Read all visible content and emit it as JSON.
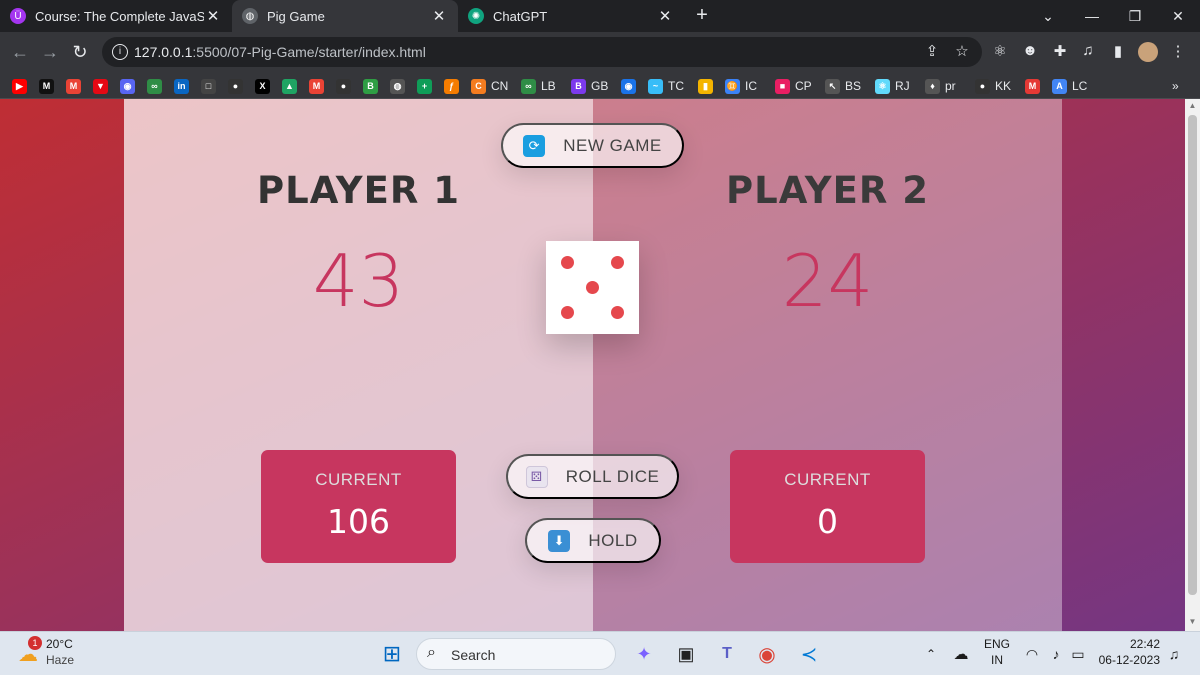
{
  "browser": {
    "tabs": [
      {
        "title": "Course: The Complete JavaScript",
        "icon": "udemy-icon",
        "color": "#a435f0"
      },
      {
        "title": "Pig Game",
        "icon": "globe-icon",
        "color": "#8ab4f8"
      },
      {
        "title": "ChatGPT",
        "icon": "chatgpt-icon",
        "color": "#10a37f"
      }
    ],
    "url_host": "127.0.0.1",
    "url_path": ":5500/07-Pig-Game/starter/index.html",
    "bookmarks": [
      {
        "label": "",
        "color": "#ff0000",
        "glyph": "▶"
      },
      {
        "label": "",
        "color": "#111111",
        "glyph": "M"
      },
      {
        "label": "",
        "color": "#ea4335",
        "glyph": "M"
      },
      {
        "label": "",
        "color": "#e50914",
        "glyph": "▼"
      },
      {
        "label": "",
        "color": "#5865f2",
        "glyph": "◉"
      },
      {
        "label": "",
        "color": "#2f8d46",
        "glyph": "∞"
      },
      {
        "label": "",
        "color": "#0a66c2",
        "glyph": "in"
      },
      {
        "label": "",
        "color": "#444444",
        "glyph": "□"
      },
      {
        "label": "",
        "color": "#333333",
        "glyph": "●"
      },
      {
        "label": "",
        "color": "#000000",
        "glyph": "X"
      },
      {
        "label": "",
        "color": "#1fa463",
        "glyph": "▲"
      },
      {
        "label": "",
        "color": "#ea4335",
        "glyph": "M"
      },
      {
        "label": "",
        "color": "#333333",
        "glyph": "●"
      },
      {
        "label": "",
        "color": "#2f9e44",
        "glyph": "B"
      },
      {
        "label": "",
        "color": "#555555",
        "glyph": "◍"
      },
      {
        "label": "",
        "color": "#0f9d58",
        "glyph": "+"
      },
      {
        "label": "",
        "color": "#f57c00",
        "glyph": "ƒ"
      },
      {
        "label": "CN",
        "color": "#f47c20",
        "glyph": "C"
      },
      {
        "label": "LB",
        "color": "#2f8d46",
        "glyph": "∞"
      },
      {
        "label": "GB",
        "color": "#7c3aed",
        "glyph": "B"
      },
      {
        "label": "",
        "color": "#1a73e8",
        "glyph": "◉"
      },
      {
        "label": "TC",
        "color": "#38bdf8",
        "glyph": "~"
      },
      {
        "label": "",
        "color": "#f4b400",
        "glyph": "▮"
      },
      {
        "label": "IC",
        "color": "#3b82f6",
        "glyph": "♊"
      },
      {
        "label": "CP",
        "color": "#e91e63",
        "glyph": "■"
      },
      {
        "label": "BS",
        "color": "#555555",
        "glyph": "↖"
      },
      {
        "label": "RJ",
        "color": "#61dafb",
        "glyph": "⚛"
      },
      {
        "label": "pr",
        "color": "#555555",
        "glyph": "♦"
      },
      {
        "label": "KK",
        "color": "#333333",
        "glyph": "●"
      },
      {
        "label": "",
        "color": "#e53935",
        "glyph": "M"
      },
      {
        "label": "LC",
        "color": "#4285f4",
        "glyph": "A"
      }
    ],
    "more_label": "»"
  },
  "game": {
    "player1": {
      "name": "PLAYER 1",
      "score": "43",
      "current_label": "CURRENT",
      "current": "106"
    },
    "player2": {
      "name": "PLAYER 2",
      "score": "24",
      "current_label": "CURRENT",
      "current": "0"
    },
    "buttons": {
      "new_game": "NEW GAME",
      "roll_dice": "ROLL DICE",
      "hold": "HOLD"
    },
    "dice_value": 5,
    "colors": {
      "accent": "#c7365f",
      "pip": "#e5484d"
    }
  },
  "taskbar": {
    "weather_temp": "20°C",
    "weather_desc": "Haze",
    "weather_badge": "1",
    "search_placeholder": "Search",
    "lang_top": "ENG",
    "lang_bottom": "IN",
    "time": "22:42",
    "date": "06-12-2023"
  }
}
